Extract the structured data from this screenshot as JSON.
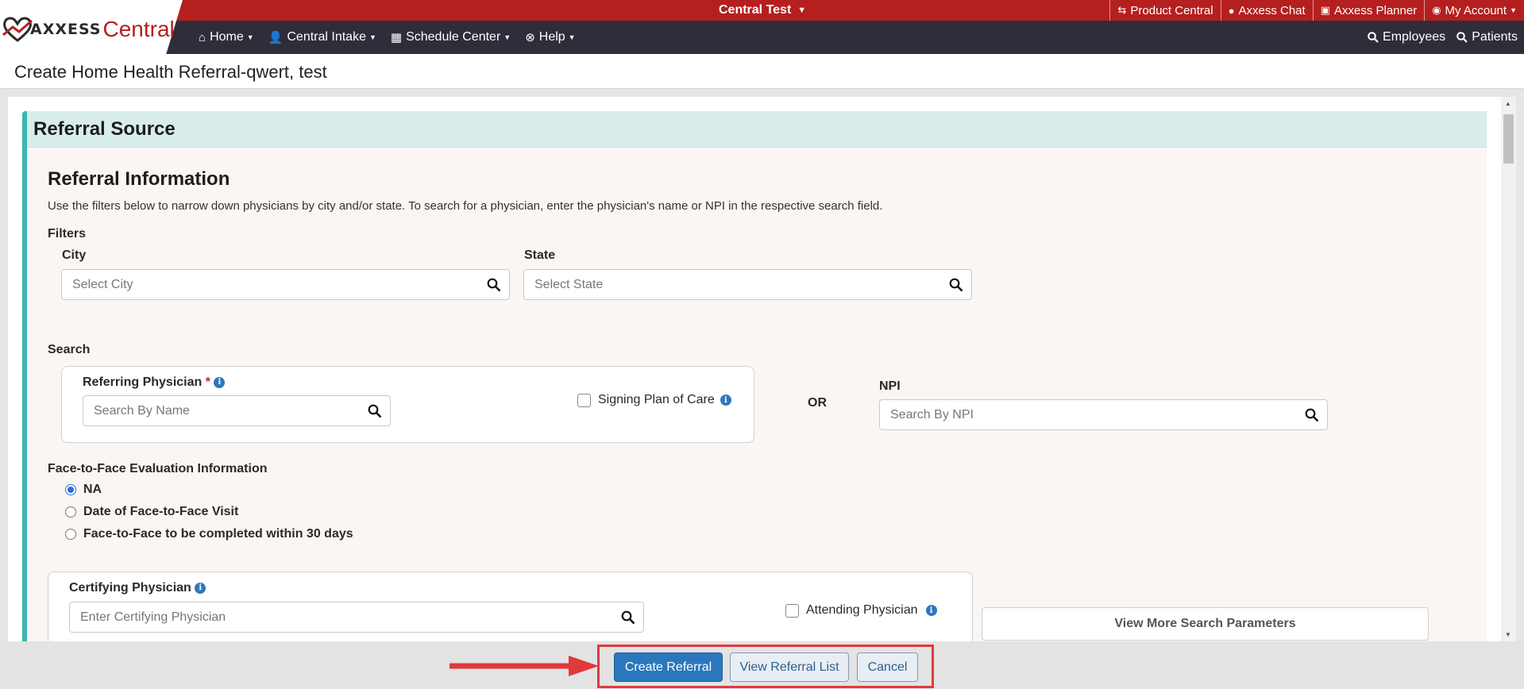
{
  "header": {
    "logo": {
      "brand": "AXXESS",
      "product": "Central"
    },
    "org_switcher": "Central Test",
    "top_links": [
      {
        "label": "Product Central",
        "icon": "exchange-icon"
      },
      {
        "label": "Axxess Chat",
        "icon": "chat-icon"
      },
      {
        "label": "Axxess Planner",
        "icon": "calendar-check-icon"
      },
      {
        "label": "My Account",
        "icon": "user-circle-icon"
      }
    ],
    "nav": [
      {
        "label": "Home",
        "icon": "home-icon"
      },
      {
        "label": "Central Intake",
        "icon": "user-plus-icon"
      },
      {
        "label": "Schedule Center",
        "icon": "calendar-icon"
      },
      {
        "label": "Help",
        "icon": "lifebuoy-icon"
      }
    ],
    "nav_right": [
      {
        "label": "Employees",
        "icon": "search-icon"
      },
      {
        "label": "Patients",
        "icon": "search-icon"
      }
    ]
  },
  "page": {
    "title": "Create Home Health Referral-qwert, test"
  },
  "referral_source": {
    "header": "Referral Source",
    "section_title": "Referral Information",
    "description": "Use the filters below to narrow down physicians by city and/or state. To search for a physician, enter the physician's name or NPI in the respective search field.",
    "filters": {
      "label": "Filters",
      "city": {
        "label": "City",
        "placeholder": "Select City",
        "value": ""
      },
      "state": {
        "label": "State",
        "placeholder": "Select State",
        "value": ""
      }
    },
    "search": {
      "label": "Search",
      "referring_physician": {
        "label": "Referring Physician",
        "required_mark": "*",
        "placeholder": "Search By Name",
        "value": ""
      },
      "signing_plan_of_care": {
        "label": "Signing Plan of Care",
        "checked": false
      },
      "or_text": "OR",
      "npi": {
        "label": "NPI",
        "placeholder": "Search By NPI",
        "value": ""
      }
    },
    "face_to_face": {
      "label": "Face-to-Face Evaluation Information",
      "options": [
        {
          "label": "NA",
          "selected": true
        },
        {
          "label": "Date of Face-to-Face Visit",
          "selected": false
        },
        {
          "label": "Face-to-Face to be completed within 30 days",
          "selected": false
        }
      ]
    },
    "certifying_physician": {
      "label": "Certifying Physician",
      "placeholder": "Enter Certifying Physician",
      "value": ""
    },
    "attending_physician": {
      "label": "Attending Physician",
      "checked": false
    },
    "view_more_button": "View More Search Parameters"
  },
  "footer": {
    "create_button": "Create Referral",
    "view_list_button": "View Referral List",
    "cancel_button": "Cancel"
  },
  "colors": {
    "brand_red": "#b51f1f",
    "nav_dark": "#2f2d3a",
    "panel_accent": "#3ab7b3",
    "primary_blue": "#2b77bd",
    "annotation_red": "#e0393b"
  }
}
